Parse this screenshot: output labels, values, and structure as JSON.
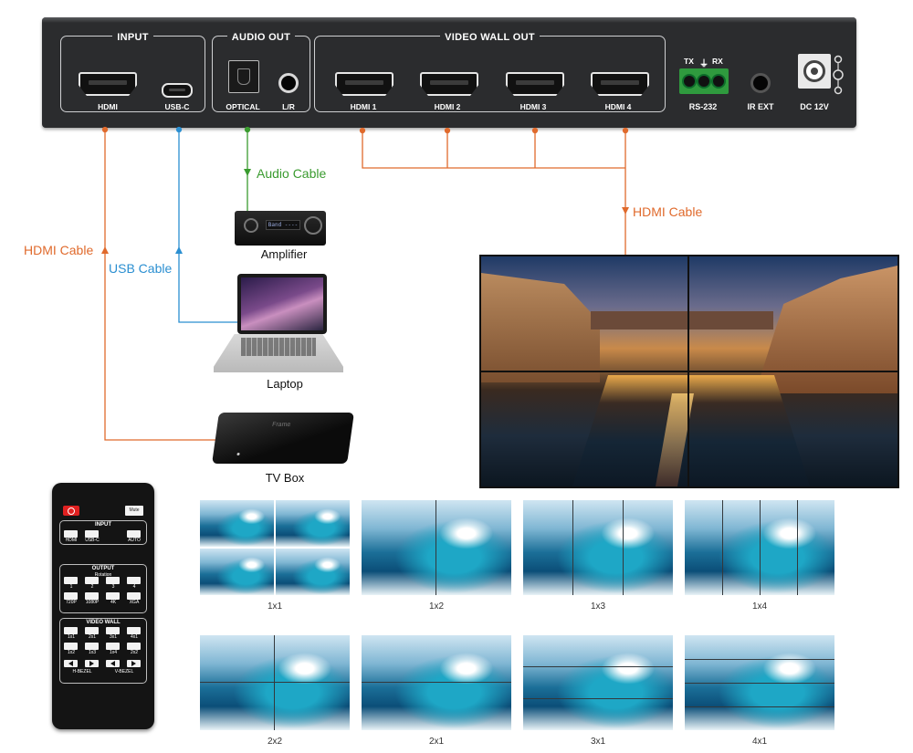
{
  "device": {
    "groups": {
      "input": "INPUT",
      "audio_out": "AUDIO OUT",
      "video_wall_out": "VIDEO WALL OUT"
    },
    "ports": {
      "hdmi": "HDMI",
      "usb_c": "USB-C",
      "optical": "OPTICAL",
      "lr": "L/R",
      "hdmi1": "HDMI 1",
      "hdmi2": "HDMI 2",
      "hdmi3": "HDMI 3",
      "hdmi4": "HDMI 4",
      "rs232": "RS-232",
      "rs232_tx": "TX",
      "rs232_gnd": "⏚",
      "rs232_rx": "RX",
      "ir_ext": "IR EXT",
      "dc": "DC 12V"
    }
  },
  "cables": {
    "audio": "Audio Cable",
    "hdmi_out": "HDMI Cable",
    "hdmi_in": "HDMI Cable",
    "usb": "USB Cable"
  },
  "colors": {
    "hdmi": "#e06a2c",
    "usb": "#2b8fd1",
    "audio": "#3a9b2f"
  },
  "devices": {
    "amplifier": "Amplifier",
    "laptop": "Laptop",
    "tvbox": "TV Box",
    "amp_display": "Band ----",
    "tvbox_brand": "Frame"
  },
  "remote": {
    "mute": "Mute",
    "input_title": "INPUT",
    "input_buttons": [
      "HDMI",
      "USB-C",
      "AUTO"
    ],
    "output_title": "OUTPUT",
    "rotation": "Rotation",
    "rotation_buttons": [
      "1",
      "2",
      "3",
      "4"
    ],
    "resolution_buttons": [
      "720P",
      "1080P",
      "4K",
      "XGA"
    ],
    "wall_title": "VIDEO WALL",
    "wall_row1": [
      "1x1",
      "2x1",
      "3x1",
      "4x1"
    ],
    "wall_row2": [
      "1x2",
      "1x3",
      "1x4",
      "2x2"
    ],
    "h_bezel": "H-BEZEL",
    "v_bezel": "V-BEZEL"
  },
  "layouts": [
    "1x1",
    "1x2",
    "1x3",
    "1x4",
    "2x2",
    "2x1",
    "3x1",
    "4x1"
  ]
}
